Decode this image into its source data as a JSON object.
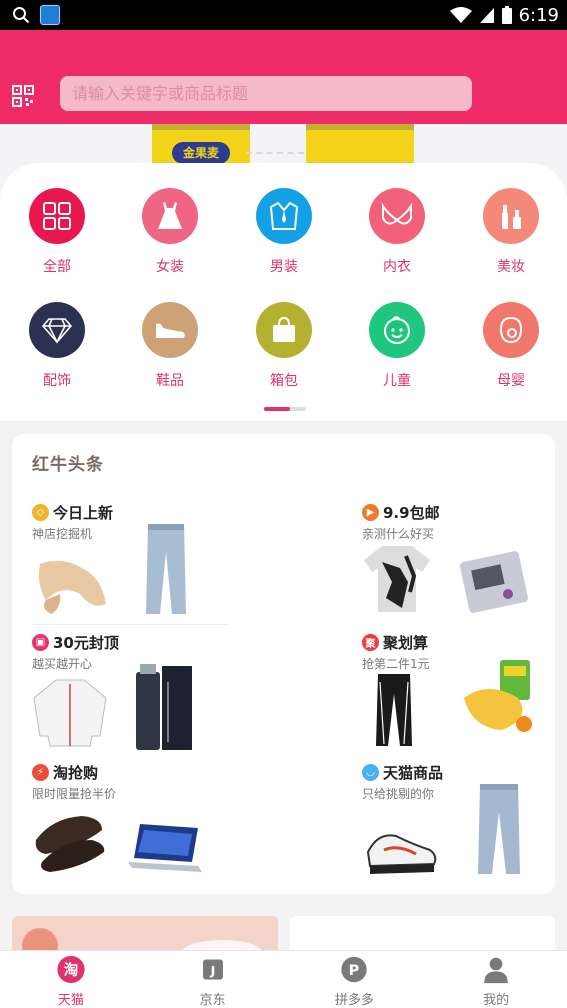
{
  "status_bar": {
    "time": "6:19"
  },
  "search": {
    "placeholder": "请输入关键字或商品标题"
  },
  "categories": [
    {
      "label": "全部",
      "icon": "grid-icon",
      "color": "#e8174e"
    },
    {
      "label": "女装",
      "icon": "dress-icon",
      "color": "#f06584"
    },
    {
      "label": "男装",
      "icon": "suit-icon",
      "color": "#14a0e6"
    },
    {
      "label": "内衣",
      "icon": "bra-icon",
      "color": "#f2617a"
    },
    {
      "label": "美妆",
      "icon": "makeup-icon",
      "color": "#f4897a"
    },
    {
      "label": "配饰",
      "icon": "diamond-icon",
      "color": "#2b3151"
    },
    {
      "label": "鞋品",
      "icon": "shoe-icon",
      "color": "#cda274"
    },
    {
      "label": "箱包",
      "icon": "bag-icon",
      "color": "#b4b131"
    },
    {
      "label": "儿童",
      "icon": "child-face-icon",
      "color": "#1fc77e"
    },
    {
      "label": "母婴",
      "icon": "mother-icon",
      "color": "#f0776c"
    }
  ],
  "news": {
    "title": "红牛头条",
    "promos": [
      {
        "title": "今日上新",
        "subtitle": "神店挖掘机",
        "icon_color": "#f0b42a"
      },
      {
        "title": "9.9包邮",
        "subtitle": "亲测什么好买",
        "icon_color": "#f07a2a"
      },
      {
        "title": "30元封顶",
        "subtitle": "越买越开心",
        "icon_color": "#e8336a"
      },
      {
        "title": "聚划算",
        "subtitle": "抢第二件1元",
        "icon_color": "#ef3b3b"
      },
      {
        "title": "淘抢购",
        "subtitle": "限时限量抢半价",
        "icon_color": "#ef4b3b"
      },
      {
        "title": "天猫商品",
        "subtitle": "只给挑剔的你",
        "icon_color": "#4ab0f0"
      }
    ],
    "banner_text": "金果麦"
  },
  "tabs": [
    {
      "label": "天猫",
      "icon": "taobao-icon",
      "active": true
    },
    {
      "label": "京东",
      "icon": "jd-icon",
      "active": false
    },
    {
      "label": "拼多多",
      "icon": "pinduoduo-icon",
      "active": false
    },
    {
      "label": "我的",
      "icon": "user-icon",
      "active": false
    }
  ],
  "colors": {
    "brand": "#ee2b67",
    "accent": "#e0316c"
  }
}
